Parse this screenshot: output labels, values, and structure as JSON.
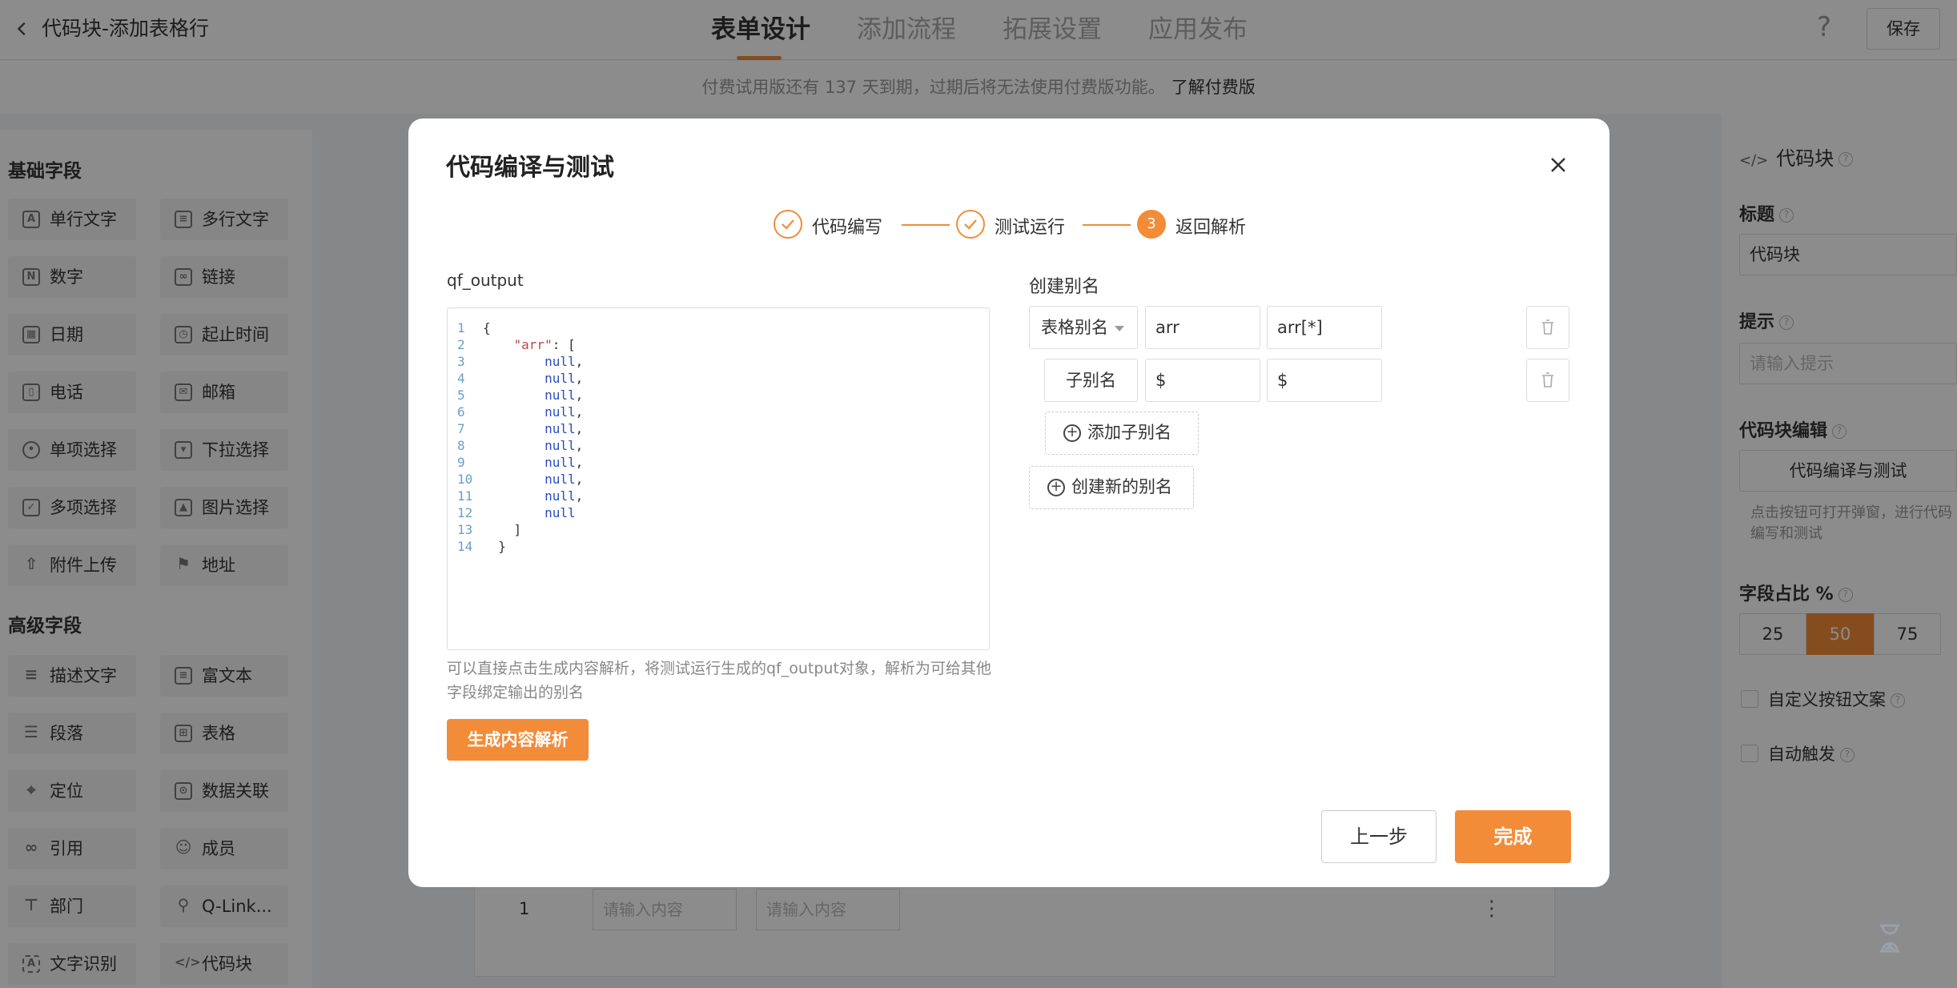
{
  "header": {
    "title": "代码块-添加表格行",
    "tabs": [
      "表单设计",
      "添加流程",
      "拓展设置",
      "应用发布"
    ],
    "active_tab": "表单设计",
    "help": "?",
    "save_label": "保存"
  },
  "notice": {
    "text": "付费试用版还有 137 天到期，过期后将无法使用付费版功能。",
    "link": "了解付费版"
  },
  "palette": {
    "basic_title": "基础字段",
    "basic": [
      "单行文字",
      "多行文字",
      "数字",
      "链接",
      "日期",
      "起止时间",
      "电话",
      "邮箱",
      "单项选择",
      "下拉选择",
      "多项选择",
      "图片选择",
      "附件上传",
      "地址"
    ],
    "advanced_title": "高级字段",
    "advanced": [
      "描述文字",
      "富文本",
      "段落",
      "表格",
      "定位",
      "数据关联",
      "引用",
      "成员",
      "部门",
      "Q-Link...",
      "文字识别",
      "代码块"
    ]
  },
  "canvas": {
    "row_number": "1",
    "input_placeholder": "请输入内容"
  },
  "props": {
    "header": "代码块",
    "title_label": "标题",
    "title_value": "代码块",
    "hint_label": "提示",
    "hint_placeholder": "请输入提示",
    "code_edit_label": "代码块编辑",
    "code_edit_button": "代码编译与测试",
    "code_edit_note": "点击按钮可打开弹窗，进行代码编写和测试",
    "width_label": "字段占比 %",
    "width_options": [
      "25",
      "50",
      "75"
    ],
    "width_selected": "50",
    "custom_btn_label": "自定义按钮文案",
    "auto_trigger_label": "自动触发"
  },
  "modal": {
    "title": "代码编译与测试",
    "steps": [
      {
        "label": "代码编写",
        "status": "done"
      },
      {
        "label": "测试运行",
        "status": "done"
      },
      {
        "label": "返回解析",
        "status": "current",
        "number": "3"
      }
    ],
    "output_label": "qf_output",
    "code_lines": [
      "{",
      "    \"arr\": [",
      "        null,",
      "        null,",
      "        null,",
      "        null,",
      "        null,",
      "        null,",
      "        null,",
      "        null,",
      "        null,",
      "        null",
      "    ]",
      "  }"
    ],
    "hint": "可以直接点击生成内容解析，将测试运行生成的qf_output对象，解析为可给其他字段绑定输出的别名",
    "generate_label": "生成内容解析",
    "alias_title": "创建别名",
    "table_alias_select": "表格别名",
    "alias_row1": {
      "name": "arr",
      "path": "arr[*]"
    },
    "sub_alias_label": "子别名",
    "alias_row2": {
      "name": "$",
      "path": "$"
    },
    "add_sub_alias": "添加子别名",
    "create_alias": "创建新的别名",
    "prev_label": "上一步",
    "done_label": "完成"
  },
  "colors": {
    "accent": "#f28c38",
    "overlay": "rgba(0,0,0,0.45)"
  }
}
